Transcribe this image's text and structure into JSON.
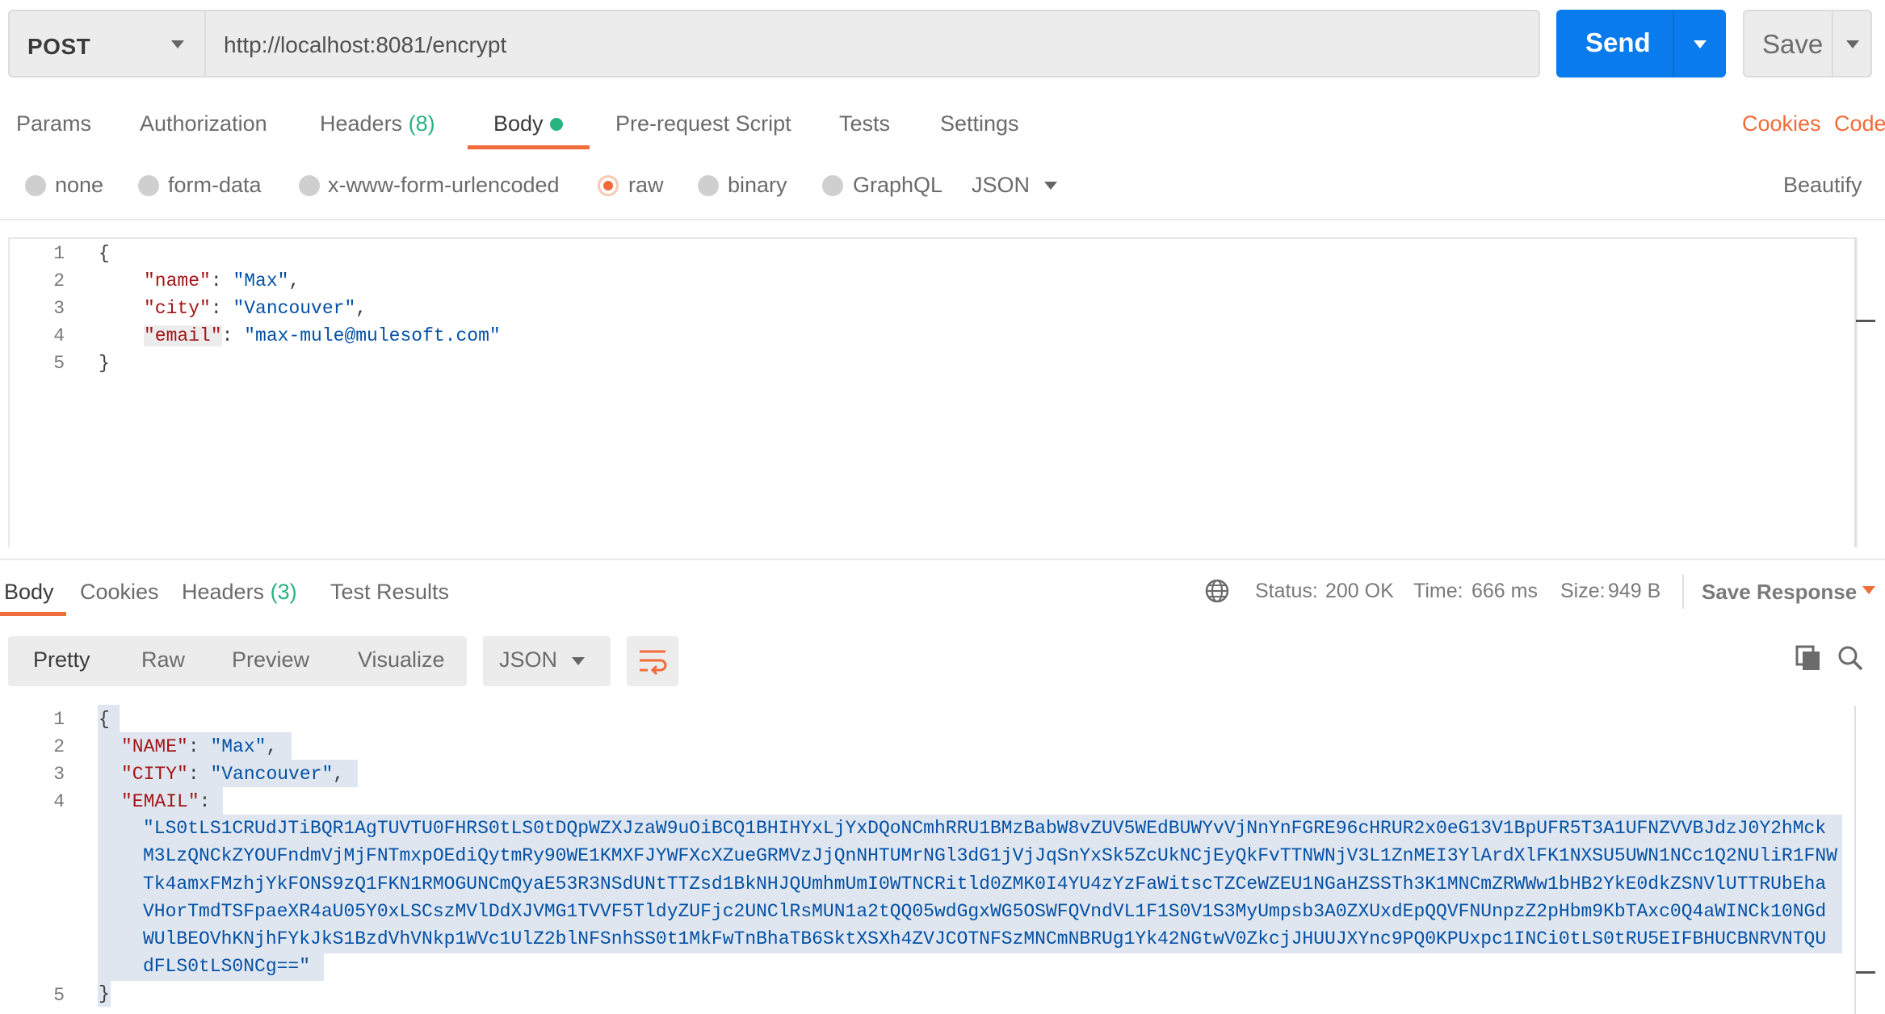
{
  "request": {
    "method": "POST",
    "url": "http://localhost:8081/encrypt",
    "send_label": "Send",
    "save_label": "Save"
  },
  "request_tabs": {
    "params": "Params",
    "authorization": "Authorization",
    "headers": "Headers",
    "headers_count": "(8)",
    "body": "Body",
    "pre_request_script": "Pre-request Script",
    "tests": "Tests",
    "settings": "Settings",
    "cookies": "Cookies",
    "code": "Code"
  },
  "body_types": {
    "none": "none",
    "form_data": "form-data",
    "urlencoded": "x-www-form-urlencoded",
    "raw": "raw",
    "binary": "binary",
    "graphql": "GraphQL",
    "language": "JSON",
    "beautify": "Beautify",
    "selected": "raw"
  },
  "request_body": {
    "line_numbers": [
      "1",
      "2",
      "3",
      "4",
      "5"
    ],
    "open_brace": "{",
    "close_brace": "}",
    "fields": [
      {
        "key": "\"name\"",
        "value": "\"Max\"",
        "sep": ","
      },
      {
        "key": "\"city\"",
        "value": "\"Vancouver\"",
        "sep": ","
      },
      {
        "key": "\"email\"",
        "value": "\"max-mule@mulesoft.com\"",
        "sep": ""
      }
    ]
  },
  "response_tabs": {
    "body": "Body",
    "cookies": "Cookies",
    "headers": "Headers",
    "headers_count": "(3)",
    "test_results": "Test Results"
  },
  "response_meta": {
    "status_label": "Status:",
    "status_value": "200 OK",
    "time_label": "Time:",
    "time_value": "666 ms",
    "size_label": "Size:",
    "size_value": "949 B",
    "save_response": "Save Response"
  },
  "response_view": {
    "pretty": "Pretty",
    "raw": "Raw",
    "preview": "Preview",
    "visualize": "Visualize",
    "format": "JSON"
  },
  "response_body": {
    "line_numbers": [
      "1",
      "2",
      "3",
      "4",
      "5"
    ],
    "open_brace": "{",
    "close_brace": "}",
    "name_key": "\"NAME\"",
    "name_value": "\"Max\"",
    "city_key": "\"CITY\"",
    "city_value": "\"Vancouver\"",
    "email_key": "\"EMAIL\"",
    "email_lines": [
      "\"LS0tLS1CRUdJTiBQR1AgTUVTU0FHRS0tLS0tDQpWZXJzaW9uOiBCQ1BHIHYxLjYxDQoNCmhRRU1BMzBabW8vZUV5WEdBUWYvVjNnYnFGRE96cHRUR2x0eG13V1BpUFR5T3A1UFNZVVBJdzJ0Y2hMck",
      "M3LzQNCkZYOUFndmVjMjFNTmxpOEdiQytmRy90WE1KMXFJYWFXcXZueGRMVzJjQnNHTUMrNGl3dG1jVjJqSnYxSk5ZcUkNCjEyQkFvTTNWNjV3L1ZnMEI3YlArdXlFK1NXSU5UWN1NCc1Q2NUliR1FNW",
      "Tk4amxFMzhjYkFONS9zQ1FKN1RMOGUNCmQyaE53R3NSdUNtTTZsd1BkNHJQUmhmUmI0WTNCRitld0ZMK0I4YU4zYzFaWitscTZCeWZEU1NGaHZSSTh3K1MNCmZRWWw1bHB2YkE0dkZSNVlUTTRUbEha",
      "VHorTmdTSFpaeXR4aU05Y0xLSCszMVlDdXJVMG1TVVF5TldyZUFjc2UNClRsMUN1a2tQQ05wdGgxWG5OSWFQVndVL1F1S0V1S3MyUmpsb3A0ZXUxdEpQQVFNUnpzZ2pHbm9KbTAxc0Q4aWINCk10NGd",
      "WUlBEOVhKNjhFYkJkS1BzdVhVNkp1WVc1UlZ2blNFSnhSS0t1MkFwTnBhaTB6SktXSXh4ZVJCOTNFSzMNCmNBRUg1Yk42NGtwV0ZkcjJHUUJXYnc9PQ0KPUxpc1INCi0tLS0tRU5EIFBHUCBNRVNTQU",
      "dFLS0tLS0NCg==\""
    ]
  }
}
